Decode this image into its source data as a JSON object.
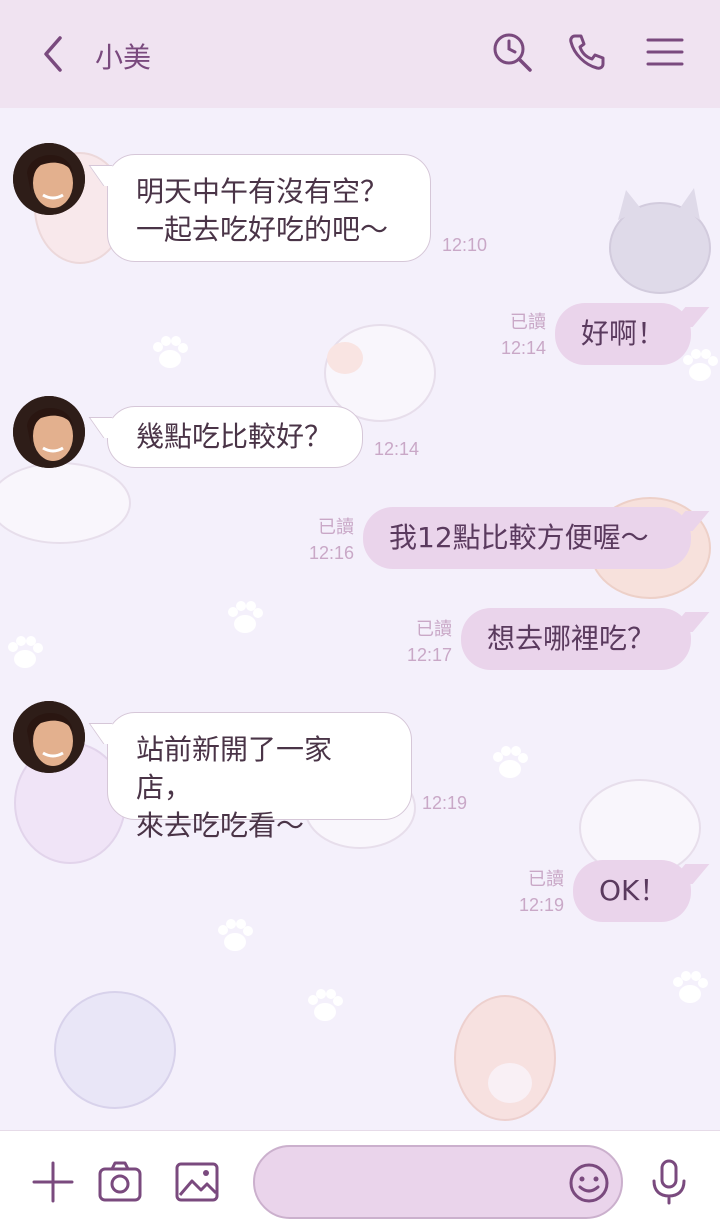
{
  "header": {
    "title": "小美"
  },
  "messages": [
    {
      "side": "in",
      "lines": [
        "明天中午有沒有空？",
        "一起去吃好吃的吧～"
      ],
      "time": "12:10"
    },
    {
      "side": "out",
      "text": "好啊！",
      "read": "已讀",
      "time": "12:14"
    },
    {
      "side": "in",
      "lines": [
        "幾點吃比較好？"
      ],
      "time": "12:14"
    },
    {
      "side": "out",
      "text": "我12點比較方便喔～",
      "read": "已讀",
      "time": "12:16"
    },
    {
      "side": "out",
      "text": "想去哪裡吃？",
      "read": "已讀",
      "time": "12:17"
    },
    {
      "side": "in",
      "lines": [
        "站前新開了一家店，",
        "來去吃吃看～"
      ],
      "time": "12:19"
    },
    {
      "side": "out",
      "text": "OK！",
      "read": "已讀",
      "time": "12:19"
    }
  ],
  "composer": {
    "value": ""
  },
  "icons": {
    "back": "chevron-left-icon",
    "search": "search-clock-icon",
    "call": "phone-icon",
    "menu": "hamburger-menu-icon",
    "add": "plus-icon",
    "camera": "camera-icon",
    "image": "image-icon",
    "emoji": "smiley-icon",
    "mic": "microphone-icon"
  },
  "colors": {
    "header_bg": "#f0e3f1",
    "bubble_out": "#ead4eb",
    "accent": "#7a4a7e",
    "background": "#f4f0fb"
  }
}
